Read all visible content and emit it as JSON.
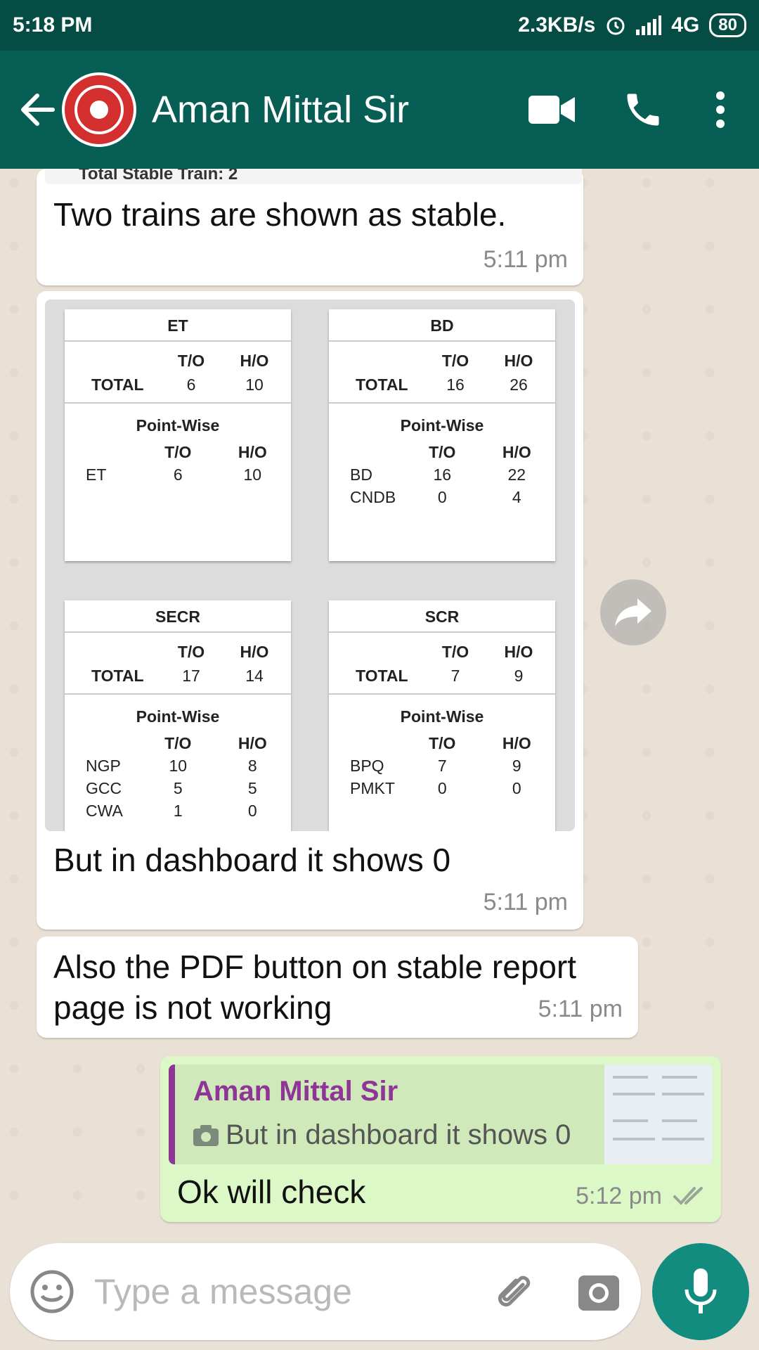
{
  "status_bar": {
    "time": "5:18 PM",
    "speed": "2.3KB/s",
    "network": "4G",
    "battery": "80"
  },
  "header": {
    "contact_name": "Aman Mittal Sir"
  },
  "messages": [
    {
      "text": "Two trains are shown as stable.",
      "time": "5:11 pm",
      "image_caption_strip": "Total Stable Train: 2"
    },
    {
      "text": "But in dashboard it shows 0",
      "time": "5:11 pm"
    },
    {
      "text": "Also the PDF button on stable report page is not working",
      "time": "5:11 pm"
    },
    {
      "text": "Ok will check",
      "time": "5:12 pm",
      "reply_to": {
        "name": "Aman Mittal Sir",
        "text": "But in dashboard it shows 0"
      }
    }
  ],
  "image_cards": [
    {
      "title": "ET",
      "col_to": "T/O",
      "col_ho": "H/O",
      "total_label": "TOTAL",
      "total_to": "6",
      "total_ho": "10",
      "pw_title": "Point-Wise",
      "rows": [
        {
          "name": "ET",
          "to": "6",
          "ho": "10"
        }
      ]
    },
    {
      "title": "BD",
      "col_to": "T/O",
      "col_ho": "H/O",
      "total_label": "TOTAL",
      "total_to": "16",
      "total_ho": "26",
      "pw_title": "Point-Wise",
      "rows": [
        {
          "name": "BD",
          "to": "16",
          "ho": "22"
        },
        {
          "name": "CNDB",
          "to": "0",
          "ho": "4"
        }
      ]
    },
    {
      "title": "SECR",
      "col_to": "T/O",
      "col_ho": "H/O",
      "total_label": "TOTAL",
      "total_to": "17",
      "total_ho": "14",
      "pw_title": "Point-Wise",
      "rows": [
        {
          "name": "NGP",
          "to": "10",
          "ho": "8"
        },
        {
          "name": "GCC",
          "to": "5",
          "ho": "5"
        },
        {
          "name": "CWA",
          "to": "1",
          "ho": "0"
        }
      ]
    },
    {
      "title": "SCR",
      "col_to": "T/O",
      "col_ho": "H/O",
      "total_label": "TOTAL",
      "total_to": "7",
      "total_ho": "9",
      "pw_title": "Point-Wise",
      "rows": [
        {
          "name": "BPQ",
          "to": "7",
          "ho": "9"
        },
        {
          "name": "PMKT",
          "to": "0",
          "ho": "0"
        }
      ]
    }
  ],
  "composer": {
    "placeholder": "Type a message"
  },
  "colors": {
    "header": "#075e54",
    "status_bar": "#054d44",
    "outgoing": "#dcf8c6",
    "fab": "#128c7e",
    "reply_accent": "#8e3596"
  }
}
